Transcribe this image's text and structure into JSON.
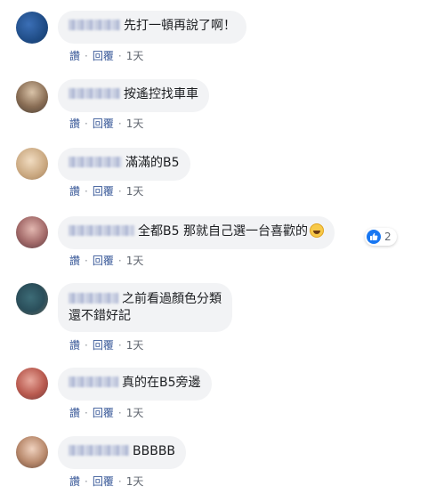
{
  "actions": {
    "like": "讚",
    "reply": "回覆",
    "separator": "·"
  },
  "comments": [
    {
      "text": "先打一頓再說了啊！",
      "time": "1天"
    },
    {
      "text": "按遙控找車車",
      "time": "1天"
    },
    {
      "text": "滿滿的B5",
      "time": "1天"
    },
    {
      "text": "全都B5 那就自己選一台喜歡的",
      "emoji": "grinning-squint-face",
      "time": "1天",
      "reaction_count": "2"
    },
    {
      "line1": "之前看過顏色分類",
      "line2": "還不錯好記",
      "time": "1天"
    },
    {
      "text": "真的在B5旁邊",
      "time": "1天"
    },
    {
      "text": "BBBBB",
      "time": "1天"
    }
  ],
  "colors": {
    "bubble": "#f2f3f5",
    "link": "#385898",
    "meta": "#616770",
    "like_blue": "#1877f2"
  }
}
